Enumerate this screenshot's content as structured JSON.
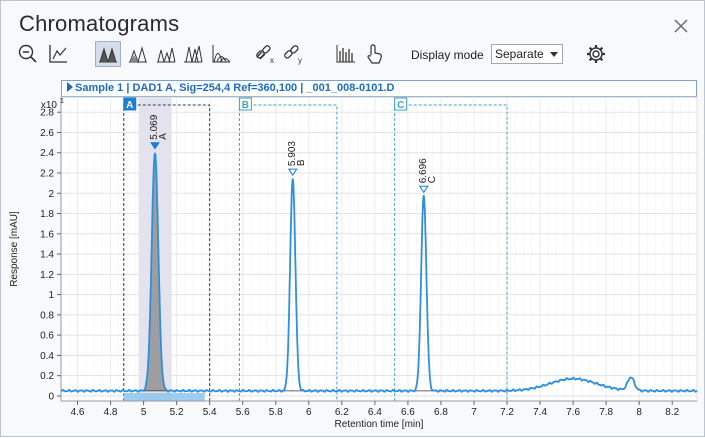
{
  "window": {
    "title": "Chromatograms"
  },
  "toolbar": {
    "buttons": [
      {
        "name": "zoom-out-icon",
        "active": false
      },
      {
        "name": "autoscale-icon",
        "active": false
      },
      {
        "name": "overlay-mode-1-icon",
        "active": true
      },
      {
        "name": "overlay-mode-2-icon",
        "active": false
      },
      {
        "name": "overlay-mode-3-icon",
        "active": false
      },
      {
        "name": "overlay-mode-4-icon",
        "active": false
      },
      {
        "name": "overlay-mode-5-icon",
        "active": false
      },
      {
        "name": "link-x-icon",
        "active": false
      },
      {
        "name": "link-y-icon",
        "active": false
      },
      {
        "name": "chart-settings-icon",
        "active": false
      },
      {
        "name": "pointer-hand-icon",
        "active": false
      }
    ],
    "display_mode_label": "Display mode",
    "display_mode_value": "Separate"
  },
  "banner": {
    "text": "Sample 1 | DAD1 A, Sig=254,4 Ref=360,100 | _001_008-0101.D"
  },
  "colors": {
    "trace": "#2f8fdc",
    "marker": "#1a7fd6",
    "region_border": "#3aa5c8",
    "banner_text": "#1a6cc0",
    "fill": "#8c8c8c"
  },
  "chart_data": {
    "type": "line",
    "xlabel": "Retention time [min]",
    "ylabel": "Response [mAU]",
    "y_multiplier_label": "x10",
    "y_multiplier_exp": "1",
    "xlim": [
      4.5,
      8.35
    ],
    "ylim": [
      -0.05,
      2.95
    ],
    "x_ticks": [
      4.6,
      4.8,
      5,
      5.2,
      5.4,
      5.6,
      5.8,
      6,
      6.2,
      6.4,
      6.6,
      6.8,
      7,
      7.2,
      7.4,
      7.6,
      7.8,
      8,
      8.2
    ],
    "x_tick_labels": [
      "4.6",
      "4.8",
      "5",
      "5.2",
      "5.4",
      "5.6",
      "5.8",
      "6",
      "6.2",
      "6.4",
      "6.6",
      "6.8",
      "7",
      "7.2",
      "7.4",
      "7.6",
      "7.8",
      "8",
      "8.2"
    ],
    "y_ticks": [
      0,
      0.2,
      0.4,
      0.6,
      0.8,
      1,
      1.2,
      1.4,
      1.6,
      1.8,
      2,
      2.2,
      2.4,
      2.6,
      2.8
    ],
    "y_tick_labels": [
      "0",
      "0.2",
      "0.4",
      "0.6",
      "0.8",
      "1",
      "1.2",
      "1.4",
      "1.6",
      "1.8",
      "2",
      "2.2",
      "2.4",
      "2.6",
      "2.8"
    ],
    "grid": true,
    "baseline": 0.05,
    "peaks": [
      {
        "rt": 5.069,
        "rt_label": "5.069",
        "name": "A",
        "height": 2.4,
        "sigma": 0.02,
        "selected": true
      },
      {
        "rt": 5.903,
        "rt_label": "5.903",
        "name": "B",
        "height": 2.14,
        "sigma": 0.016,
        "selected": false
      },
      {
        "rt": 6.696,
        "rt_label": "6.696",
        "name": "C",
        "height": 1.97,
        "sigma": 0.016,
        "selected": false
      }
    ],
    "minor_bumps": [
      {
        "rt": 7.6,
        "height": 0.12,
        "sigma": 0.14
      },
      {
        "rt": 7.95,
        "height": 0.13,
        "sigma": 0.02
      }
    ],
    "regions": [
      {
        "label": "A",
        "start": 4.88,
        "end": 5.4,
        "selected": true
      },
      {
        "label": "B",
        "start": 5.58,
        "end": 6.17,
        "selected": false
      },
      {
        "label": "C",
        "start": 6.52,
        "end": 7.2,
        "selected": false
      }
    ],
    "highlight_band": {
      "start": 4.97,
      "end": 5.17
    },
    "range_bar": {
      "start": 4.88,
      "end": 5.37
    }
  }
}
